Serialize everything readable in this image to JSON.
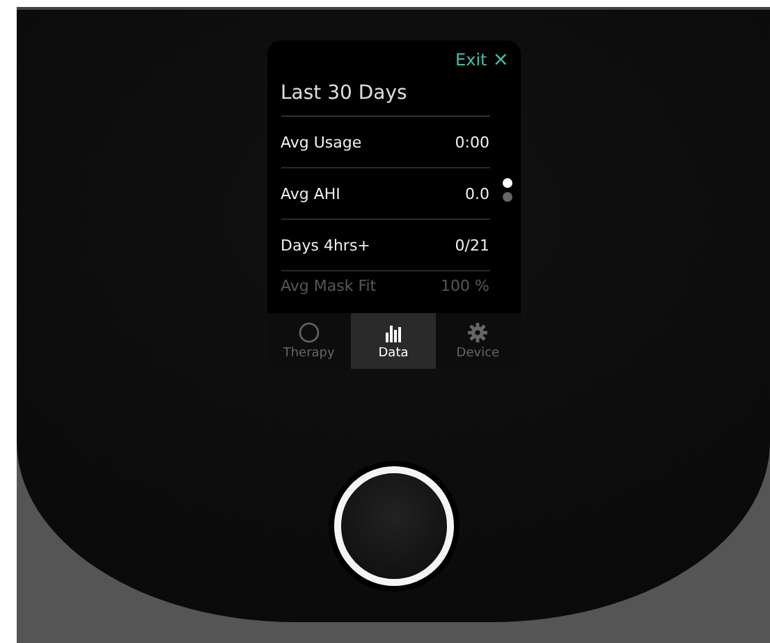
{
  "screen": {
    "exit_label": "Exit",
    "close_glyph": "×",
    "title": "Last 30 Days",
    "stats": [
      {
        "label": "Avg Usage",
        "value": "0:00",
        "faded": false
      },
      {
        "label": "Avg AHI",
        "value": "0.0",
        "faded": false
      },
      {
        "label": "Days 4hrs+",
        "value": "0/21",
        "faded": false
      },
      {
        "label": "Avg Mask Fit",
        "value": "100 %",
        "faded": true
      }
    ],
    "pages": [
      {
        "selected": true
      },
      {
        "selected": false
      }
    ],
    "tabs": [
      {
        "label": "Therapy",
        "selected": false
      },
      {
        "label": "Data",
        "selected": true
      },
      {
        "label": "Device",
        "selected": false
      }
    ]
  }
}
